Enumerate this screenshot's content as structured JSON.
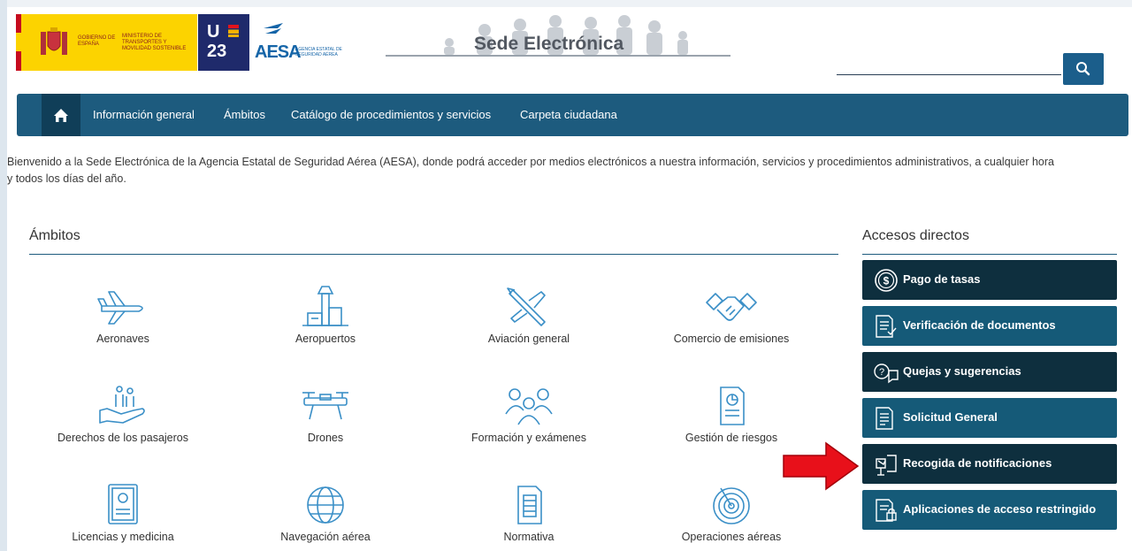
{
  "header": {
    "gov_line1": "GOBIERNO DE ESPAÑA",
    "gov_line2": "MINISTERIO DE TRANSPORTES Y MOVILIDAD SOSTENIBLE",
    "u23_top": "U",
    "u23_bottom": "23",
    "aesa_name": "AESA",
    "aesa_sub": "AGENCIA ESTATAL DE SEGURIDAD AÉREA",
    "site_title": "Sede Electrónica",
    "search": {
      "placeholder": "",
      "value": "",
      "icon": "search-icon"
    }
  },
  "nav": {
    "home_icon": "home-icon",
    "items": [
      {
        "label": "Información general"
      },
      {
        "label": "Ámbitos"
      },
      {
        "label": "Catálogo de procedimientos y servicios"
      },
      {
        "label": "Carpeta ciudadana"
      }
    ]
  },
  "welcome": {
    "line1": "Bienvenido a la Sede Electrónica de la Agencia Estatal de Seguridad Aérea (AESA), donde podrá acceder por medios electrónicos a nuestra información, servicios y procedimientos administrativos, a cualquier hora",
    "line2": "y todos los días del año."
  },
  "ambitos": {
    "title": "Ámbitos",
    "items": [
      {
        "label": "Aeronaves",
        "icon": "airplane-icon"
      },
      {
        "label": "Aeropuertos",
        "icon": "airport-tower-icon"
      },
      {
        "label": "Aviación general",
        "icon": "small-plane-icon"
      },
      {
        "label": "Comercio de emisiones",
        "icon": "handshake-icon"
      },
      {
        "label": "Derechos de los pasajeros",
        "icon": "passengers-hand-icon"
      },
      {
        "label": "Drones",
        "icon": "drone-icon"
      },
      {
        "label": "Formación y exámenes",
        "icon": "group-people-icon"
      },
      {
        "label": "Gestión de riesgos",
        "icon": "risk-document-icon"
      },
      {
        "label": "Licencias y medicina",
        "icon": "license-card-icon"
      },
      {
        "label": "Navegación aérea",
        "icon": "globe-icon"
      },
      {
        "label": "Normativa",
        "icon": "regulation-document-icon"
      },
      {
        "label": "Operaciones aéreas",
        "icon": "radar-icon"
      }
    ]
  },
  "accesos": {
    "title": "Accesos directos",
    "items": [
      {
        "label": "Pago de tasas",
        "icon": "dollar-coin-icon",
        "style": "dark"
      },
      {
        "label": "Verificación de documentos",
        "icon": "document-check-icon",
        "style": "teal"
      },
      {
        "label": "Quejas y sugerencias",
        "icon": "question-chat-icon",
        "style": "dark"
      },
      {
        "label": "Solicitud General",
        "icon": "document-list-icon",
        "style": "teal"
      },
      {
        "label": "Recogida de notificaciones",
        "icon": "mailbox-icon",
        "style": "dark"
      },
      {
        "label": "Aplicaciones de acceso restringido",
        "icon": "document-lock-icon",
        "style": "teal"
      }
    ]
  },
  "colors": {
    "nav_bg": "#1d5b7e",
    "nav_home_bg": "#103e58",
    "access_dark": "#0e2f3e",
    "access_teal": "#155a78",
    "icon_blue": "#3a8fc7",
    "arrow_red": "#e8101a"
  },
  "annotation": {
    "arrow_icon": "red-arrow-icon"
  }
}
